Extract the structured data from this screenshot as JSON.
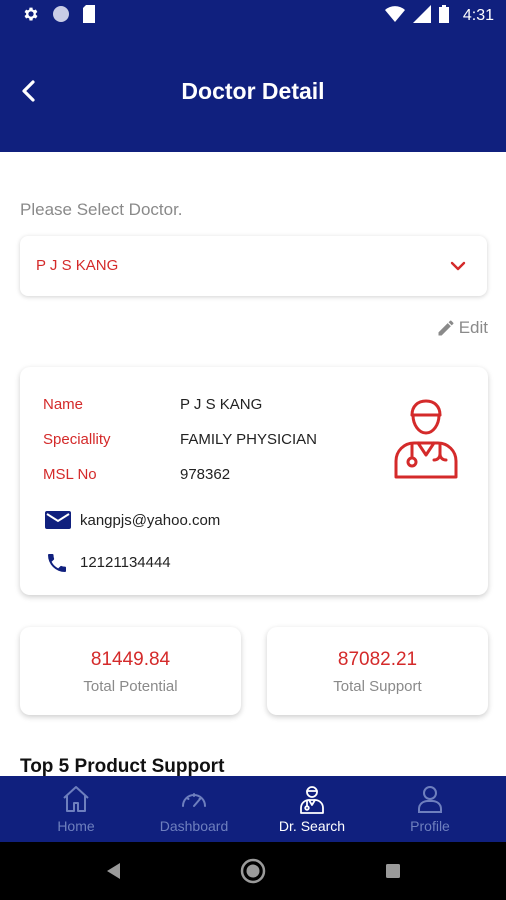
{
  "status_bar": {
    "time": "4:31",
    "icons": [
      "gear-icon",
      "circle-icon",
      "sim-card-icon",
      "wifi-icon",
      "signal-icon",
      "battery-icon"
    ]
  },
  "app_bar": {
    "title": "Doctor Detail",
    "back_icon": "chevron-left-icon"
  },
  "doctor_select": {
    "label": "Please Select Doctor.",
    "value": "P J S KANG",
    "icon": "chevron-down-icon"
  },
  "edit": {
    "label": "Edit",
    "icon": "pencil-icon"
  },
  "doctor_card": {
    "fields": [
      {
        "label": "Name",
        "value": "P J S KANG"
      },
      {
        "label": "Speciallity",
        "value": "FAMILY PHYSICIAN"
      },
      {
        "label": "MSL No",
        "value": "978362"
      }
    ],
    "email": "kangpjs@yahoo.com",
    "phone": "12121134444",
    "avatar_icon": "doctor-icon"
  },
  "stats": [
    {
      "value": "81449.84",
      "label": "Total Potential"
    },
    {
      "value": "87082.21",
      "label": "Total Support"
    }
  ],
  "section_title": "Top 5 Product Support",
  "bottom_nav": [
    {
      "label": "Home",
      "icon": "home-icon",
      "active": false
    },
    {
      "label": "Dashboard",
      "icon": "speedometer-icon",
      "active": false
    },
    {
      "label": "Dr. Search",
      "icon": "doctor-icon",
      "active": true
    },
    {
      "label": "Profile",
      "icon": "person-icon",
      "active": false
    }
  ],
  "colors": {
    "primary": "#10207e",
    "accent": "#d42a2a",
    "muted_text": "#8a8a8a",
    "inactive_nav": "#6e7fbe"
  }
}
